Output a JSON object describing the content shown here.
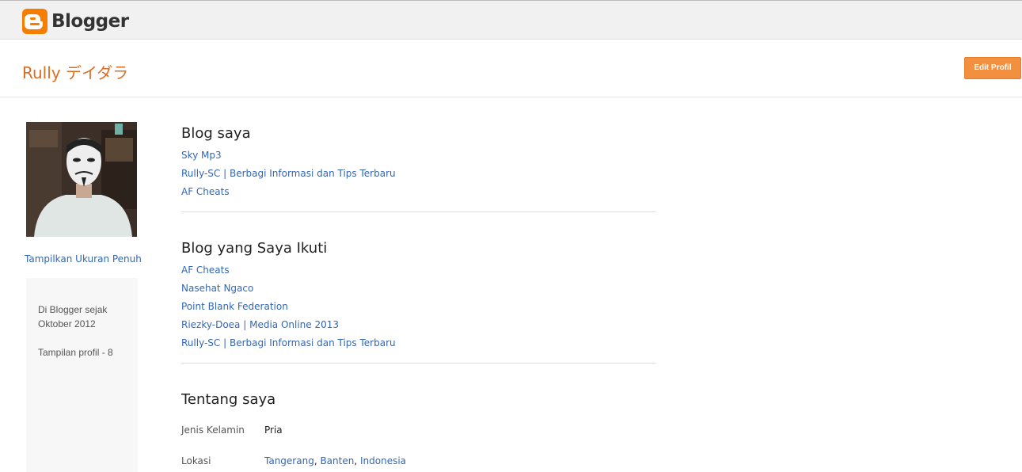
{
  "app": {
    "logo_text": "Blogger",
    "logo_icon": "blogger-b-icon",
    "brand_color": "#f57d00"
  },
  "header": {
    "profile_name": "Rully デイダラ",
    "edit_button_label": "Edit Profil"
  },
  "sidebar": {
    "avatar_alt": "profile photo",
    "fullsize_link": "Tampilkan Ukuran Penuh",
    "since_text": "Di Blogger sejak Oktober 2012",
    "views_text": "Tampilan profil - 8"
  },
  "my_blogs": {
    "title": "Blog saya",
    "items": [
      "Sky Mp3",
      "Rully-SC | Berbagi Informasi dan Tips Terbaru",
      "AF Cheats"
    ]
  },
  "followed_blogs": {
    "title": "Blog yang Saya Ikuti",
    "items": [
      "AF Cheats",
      "Nasehat Ngaco",
      "Point Blank Federation",
      "Riezky-Doea | Media Online 2013",
      "Rully-SC | Berbagi Informasi dan Tips Terbaru"
    ]
  },
  "about": {
    "title": "Tentang saya",
    "gender_label": "Jenis Kelamin",
    "gender_value": "Pria",
    "location_label": "Lokasi",
    "location_parts": [
      "Tangerang",
      "Banten",
      "Indonesia"
    ]
  },
  "colors": {
    "link": "#3367b4",
    "accent_orange": "#dd6d22",
    "button_orange": "#f3903f"
  }
}
